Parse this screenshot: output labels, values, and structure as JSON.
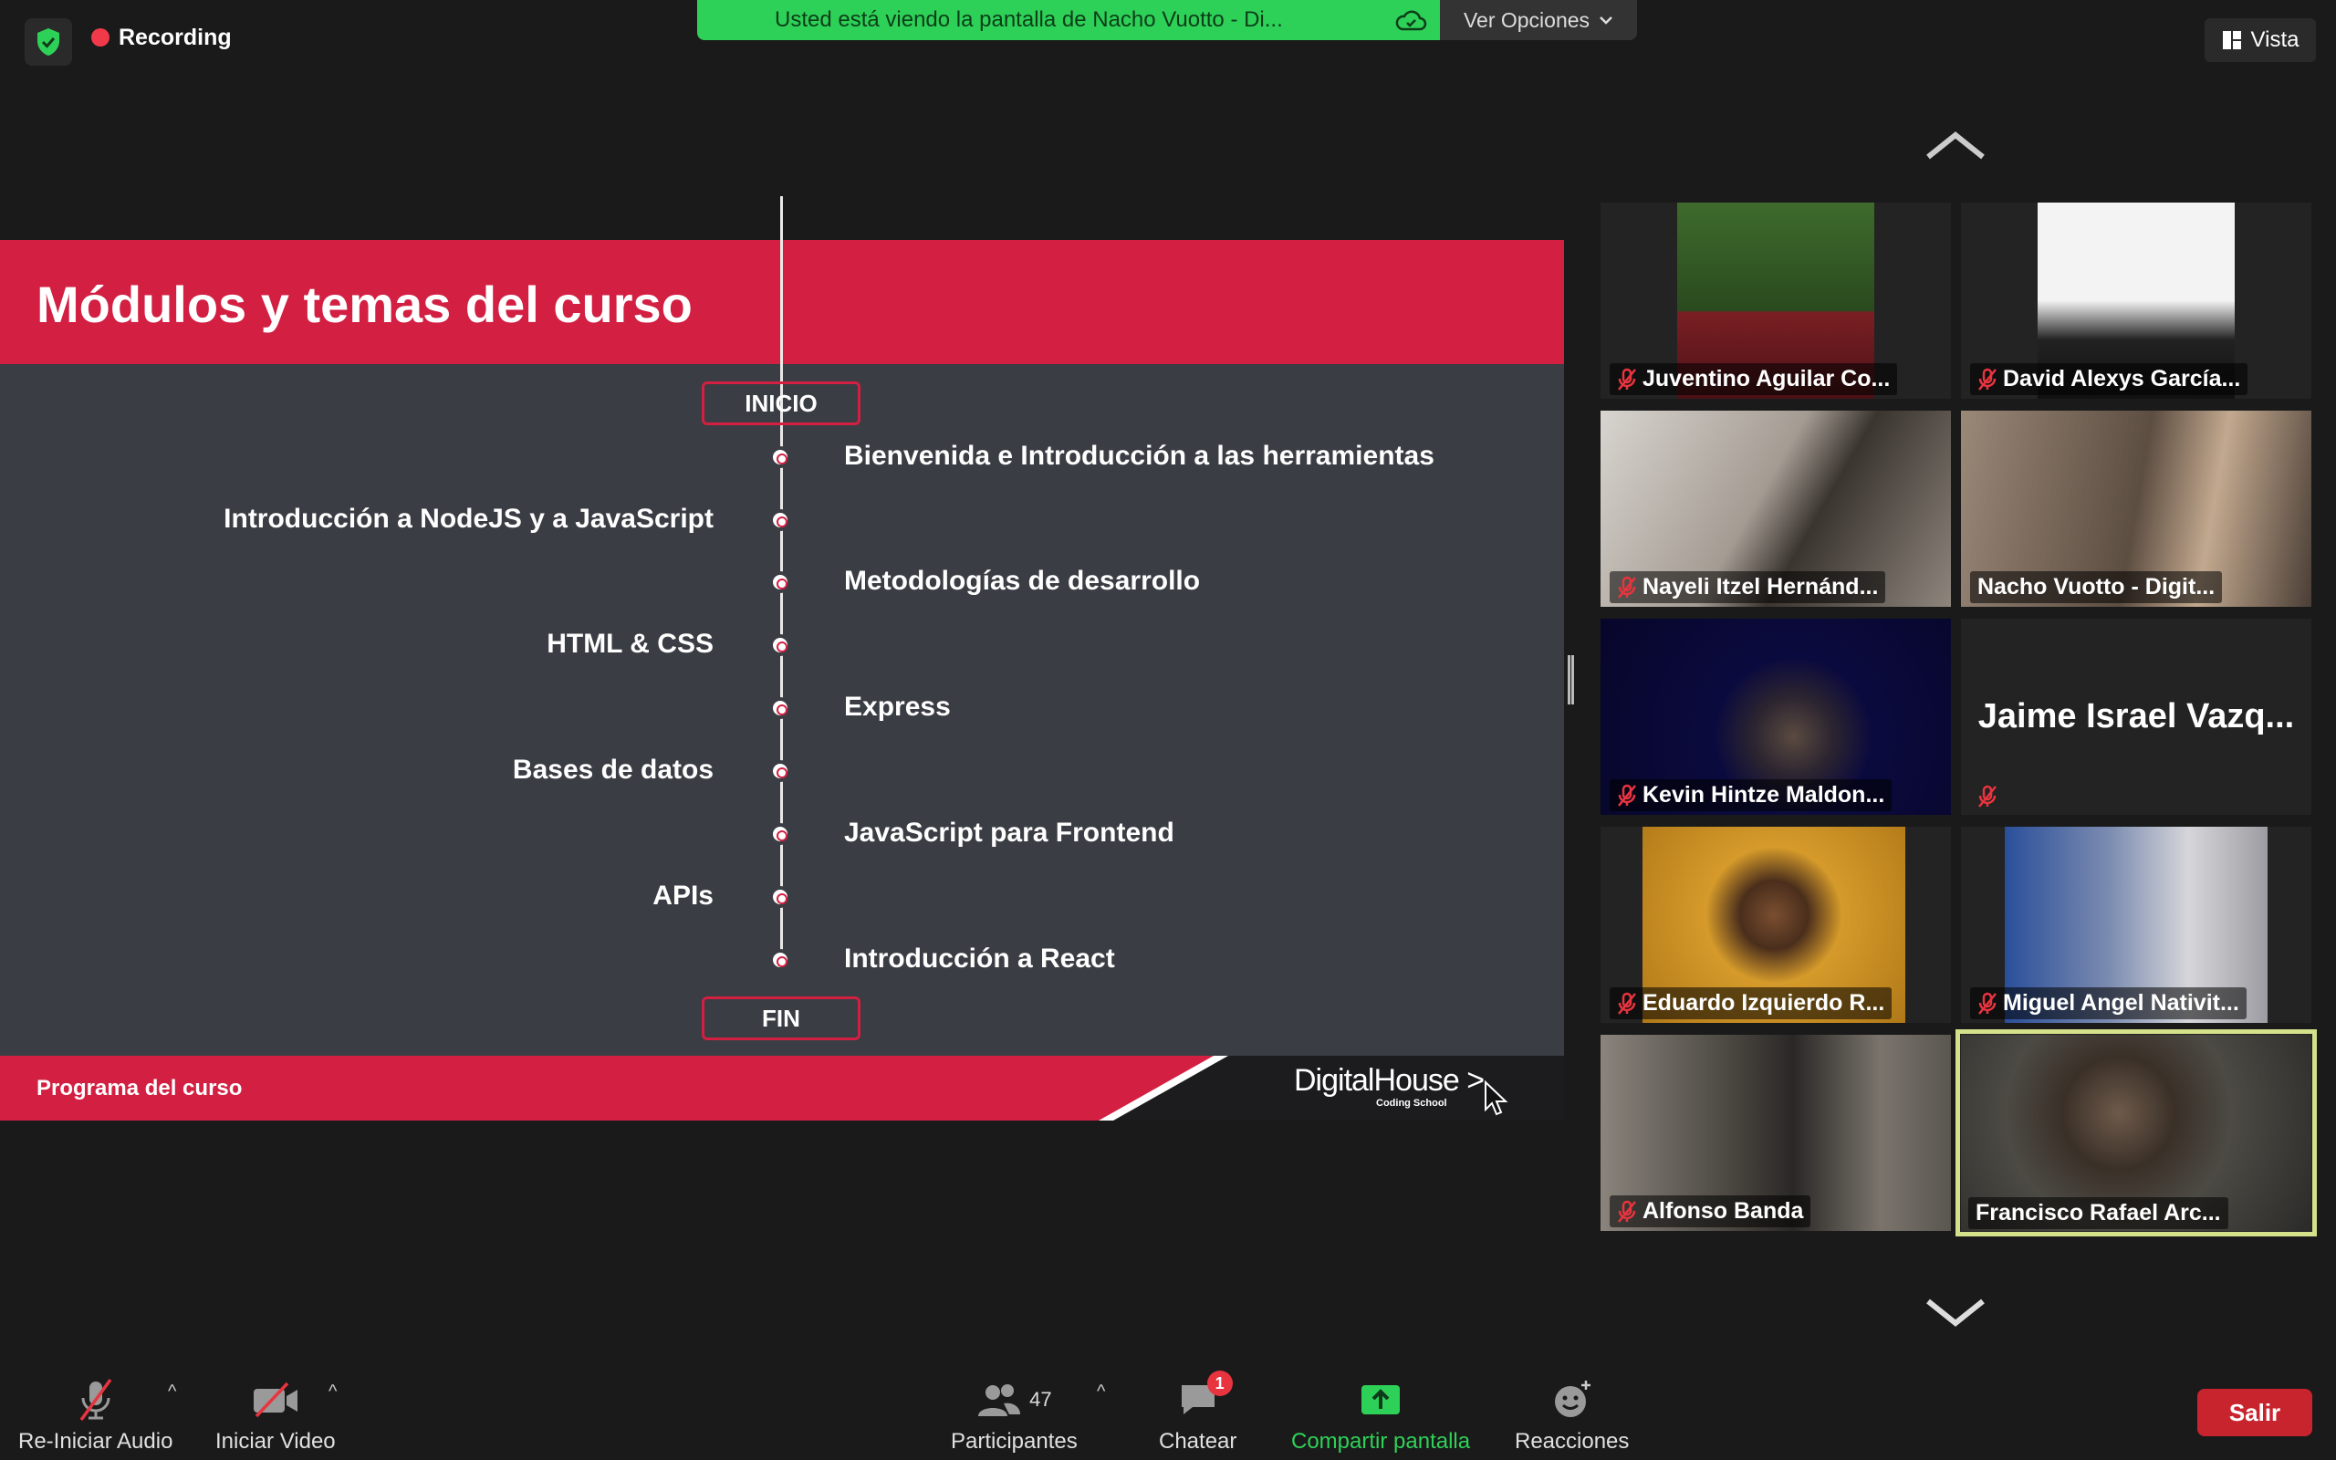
{
  "top": {
    "recording": "Recording",
    "banner_text": "Usted está viendo la pantalla de Nacho Vuotto - Di...",
    "banner_options": "Ver Opciones",
    "view_label": "Vista"
  },
  "slide": {
    "title": "Módulos y temas del curso",
    "start": "INICIO",
    "end": "FIN",
    "modules_right": [
      "Bienvenida e Introducción a las herramientas",
      "Metodologías de desarrollo",
      "Express",
      "JavaScript para Frontend",
      "Introducción a React"
    ],
    "modules_left": [
      "Introducción a NodeJS y a JavaScript",
      "HTML & CSS",
      "Bases de datos",
      "APIs"
    ],
    "footer": "Programa del curso",
    "logo_main": "DigitalHouse",
    "logo_sub": "Coding School"
  },
  "participants": [
    {
      "name": "Juventino Aguilar Co...",
      "muted": true,
      "bg": "#2e5a26"
    },
    {
      "name": "David Alexys García...",
      "muted": true,
      "bg": "#f1f1f1"
    },
    {
      "name": "Nayeli Itzel Hernánd...",
      "muted": true,
      "bg": "#9d958c"
    },
    {
      "name": "Nacho Vuotto - Digit...",
      "muted": false,
      "bg": "#6a5a4e"
    },
    {
      "name": "Kevin Hintze Maldon...",
      "muted": true,
      "bg": "#0b0a3e"
    },
    {
      "name": "Jaime Israel Vazq...",
      "muted": true,
      "bg": "#232323"
    },
    {
      "name": "Eduardo Izquierdo R...",
      "muted": true,
      "bg": "#c0861d"
    },
    {
      "name": "Miguel Angel Nativit...",
      "muted": true,
      "bg": "#5a6a8c"
    },
    {
      "name": "Alfonso Banda",
      "muted": true,
      "bg": "#6b6660"
    },
    {
      "name": "Francisco Rafael Arc...",
      "muted": false,
      "bg": "#3c3a36"
    }
  ],
  "toolbar": {
    "audio": "Re-Iniciar Audio",
    "video": "Iniciar Video",
    "participants": "Participantes",
    "participants_count": "47",
    "chat": "Chatear",
    "chat_badge": "1",
    "share": "Compartir pantalla",
    "reactions": "Reacciones",
    "leave": "Salir"
  },
  "colors": {
    "slide_red": "#d21f42",
    "share_green": "#2ed158",
    "leave_red": "#c8242e",
    "active_speaker": "#d4e08a"
  }
}
